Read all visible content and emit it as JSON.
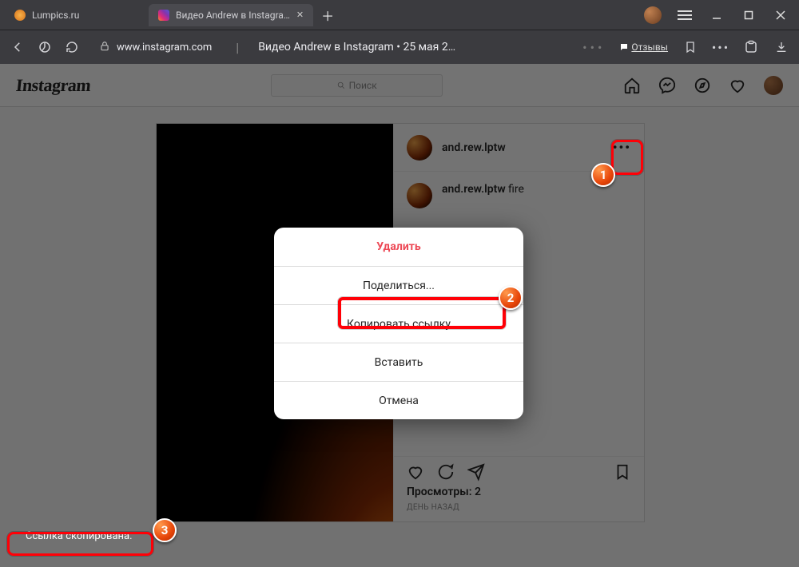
{
  "browser": {
    "tabs": [
      {
        "label": "Lumpics.ru",
        "active": false,
        "favicon_color": "#f29b26"
      },
      {
        "label": "Видео Andrew в Instagra…",
        "active": true,
        "favicon": "instagram"
      }
    ],
    "url_domain": "www.instagram.com",
    "page_title": "Видео Andrew в Instagram • 25 мая 2…",
    "reviews_label": "Отзывы"
  },
  "instagram": {
    "logo": "Instagram",
    "search_placeholder": "Поиск",
    "post": {
      "username": "and.rew.lptw",
      "caption_user": "and.rew.lptw",
      "caption_text": "fire",
      "views_label": "Просмотры:",
      "views_count": "2",
      "time_ago": "ДЕНЬ НАЗАД"
    }
  },
  "modal": {
    "delete": "Удалить",
    "share": "Поделиться...",
    "copy_link": "Копировать ссылку",
    "embed": "Вставить",
    "cancel": "Отмена"
  },
  "snackbar": {
    "text": "Ссылка скопирована."
  },
  "annotations": {
    "b1": "1",
    "b2": "2",
    "b3": "3"
  }
}
